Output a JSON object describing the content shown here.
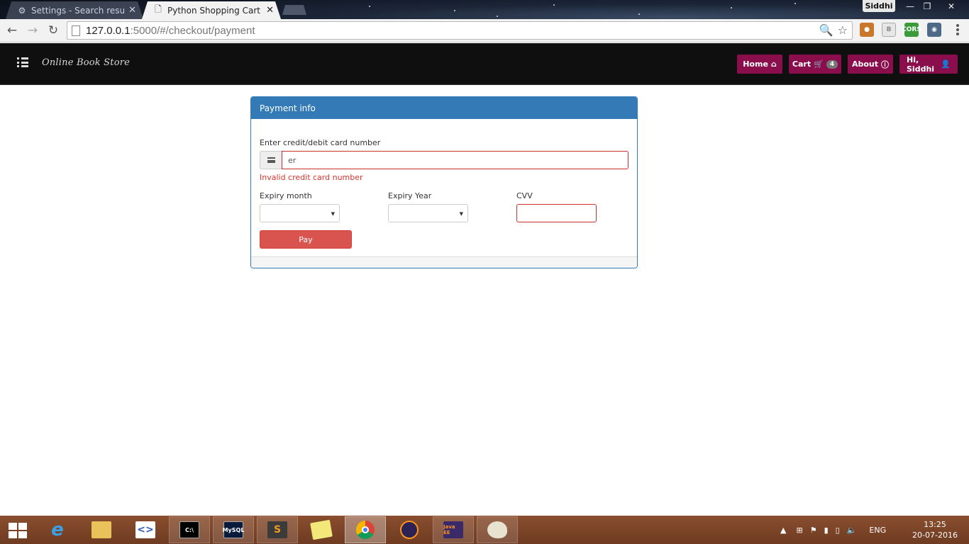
{
  "browser": {
    "tabs": [
      {
        "title": "Settings - Search results",
        "icon": "gear-icon"
      },
      {
        "title": "Python Shopping Cart",
        "icon": "page-icon"
      }
    ],
    "profile_name": "Siddhi",
    "url_host": "127.0.0.1",
    "url_rest": ":5000/#/checkout/payment"
  },
  "app": {
    "brand": "Online Book Store",
    "nav": {
      "home_label": "Home",
      "cart_label": "Cart",
      "cart_count": "4",
      "about_label": "About",
      "user_label": "Hi, Siddhi"
    },
    "accent_color": "#8a0e4c"
  },
  "payment": {
    "heading": "Payment info",
    "card_label": "Enter credit/debit card number",
    "card_value": "er",
    "card_error": "Invalid credit card number",
    "expiry_month_label": "Expiry month",
    "expiry_year_label": "Expiry Year",
    "cvv_label": "CVV",
    "pay_label": "Pay",
    "heading_color": "#337ab7",
    "error_color": "#d9332d"
  },
  "taskbar": {
    "apps": [
      "internet-explorer-icon",
      "file-explorer-icon",
      "visual-studio-icon",
      "command-prompt-icon",
      "mysql-icon",
      "sublime-text-icon",
      "sticky-notes-icon",
      "chrome-icon",
      "eclipse-icon",
      "java-ee-ide-icon",
      "paint-icon"
    ],
    "language": "ENG",
    "time": "13:25",
    "date": "20-07-2016"
  }
}
